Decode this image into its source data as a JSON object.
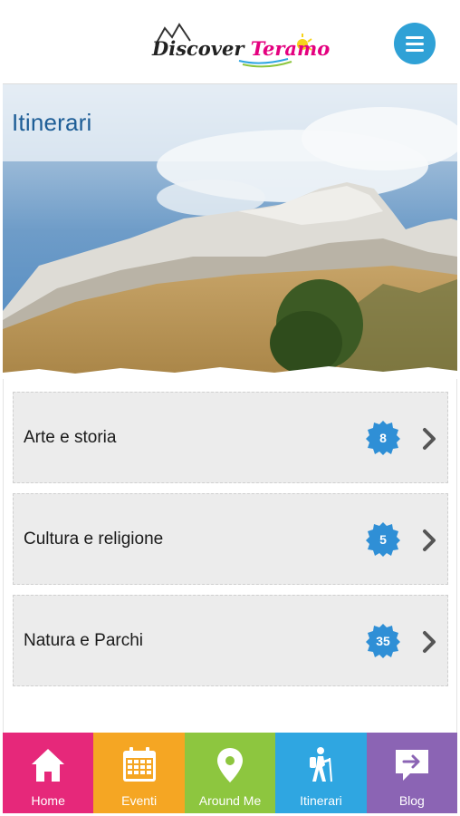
{
  "header": {
    "logo_part1": "Discover",
    "logo_part2": "Teramo"
  },
  "hero": {
    "title": "Itinerari"
  },
  "list": {
    "items": [
      {
        "label": "Arte e storia",
        "count": "8"
      },
      {
        "label": "Cultura e religione",
        "count": "5"
      },
      {
        "label": "Natura e Parchi",
        "count": "35"
      }
    ]
  },
  "tabbar": {
    "tabs": [
      {
        "label": "Home",
        "color": "#e6287a",
        "icon": "home-icon"
      },
      {
        "label": "Eventi",
        "color": "#f5a623",
        "icon": "calendar-icon"
      },
      {
        "label": "Around Me",
        "color": "#8dc63f",
        "icon": "map-pin-icon"
      },
      {
        "label": "Itinerari",
        "color": "#2fa6e1",
        "icon": "hiker-icon"
      },
      {
        "label": "Blog",
        "color": "#8b64b4",
        "icon": "chat-bubble-icon"
      }
    ]
  },
  "colors": {
    "accent": "#2fa1d6",
    "title_blue": "#1d5d96",
    "badge": "#2f8fd6"
  }
}
